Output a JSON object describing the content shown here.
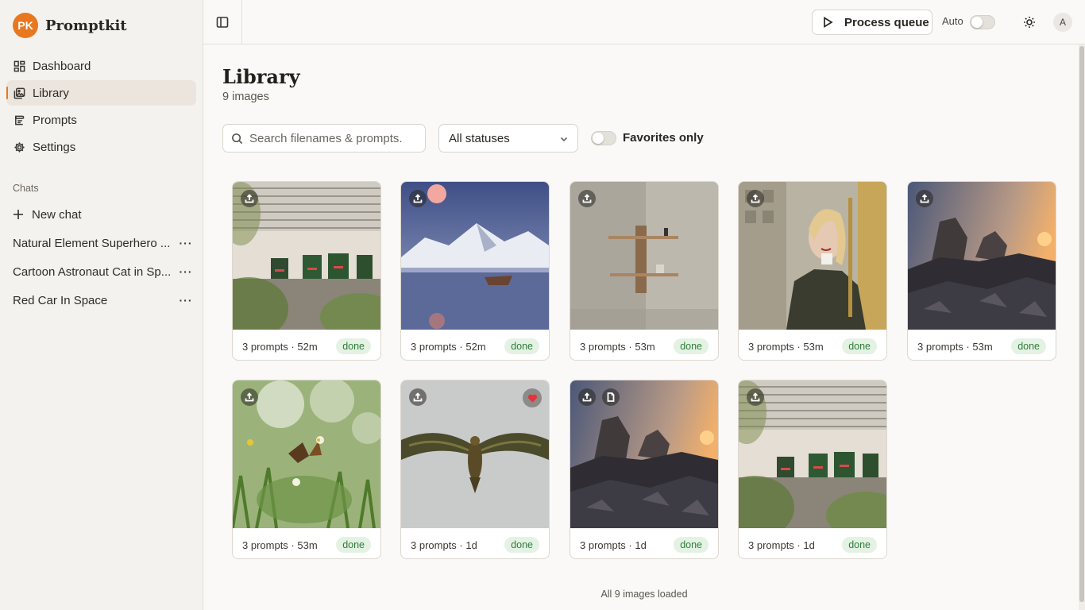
{
  "brand": {
    "initials": "PK",
    "name": "Promptkit",
    "accent": "#e8771f"
  },
  "nav": [
    {
      "label": "Dashboard",
      "icon": "dashboard-icon",
      "active": false
    },
    {
      "label": "Library",
      "icon": "library-icon",
      "active": true
    },
    {
      "label": "Prompts",
      "icon": "prompts-icon",
      "active": false
    },
    {
      "label": "Settings",
      "icon": "gear-icon",
      "active": false
    }
  ],
  "chats": {
    "section_label": "Chats",
    "new_chat_label": "New chat",
    "items": [
      {
        "title": "Natural Element Superhero ..."
      },
      {
        "title": "Cartoon Astronaut Cat in Sp..."
      },
      {
        "title": "Red Car In Space"
      }
    ]
  },
  "header": {
    "process_label": "Process queue",
    "auto_label": "Auto",
    "auto_enabled": false,
    "avatar_initial": "A"
  },
  "library": {
    "title": "Library",
    "subtitle": "9 images",
    "search_placeholder": "Search filenames & prompts.",
    "status_filter": "All statuses",
    "favorites_label": "Favorites only",
    "favorites_enabled": false,
    "footer": "All 9 images loaded",
    "items": [
      {
        "meta": "3 prompts · 52m",
        "status": "done",
        "scene": "wall-figures",
        "favorite": false
      },
      {
        "meta": "3 prompts · 52m",
        "status": "done",
        "scene": "snow-lake-boat",
        "favorite": false
      },
      {
        "meta": "3 prompts · 53m",
        "status": "done",
        "scene": "wall-shelf",
        "favorite": false
      },
      {
        "meta": "3 prompts · 53m",
        "status": "done",
        "scene": "woman-portrait",
        "favorite": false
      },
      {
        "meta": "3 prompts · 53m",
        "status": "done",
        "scene": "rocks-sunset",
        "favorite": false
      },
      {
        "meta": "3 prompts · 53m",
        "status": "done",
        "scene": "butterfly-flowers",
        "favorite": false
      },
      {
        "meta": "3 prompts · 1d",
        "status": "done",
        "scene": "bird-flight",
        "favorite": true
      },
      {
        "meta": "3 prompts · 1d",
        "status": "done",
        "scene": "rocks-sunset",
        "favorite": false
      },
      {
        "meta": "3 prompts · 1d",
        "status": "done",
        "scene": "wall-figures",
        "favorite": false
      }
    ]
  },
  "colors": {
    "status_done_text": "#2f7d3a",
    "status_done_bg": "#e4f2e4",
    "favorite": "#e5323b"
  }
}
